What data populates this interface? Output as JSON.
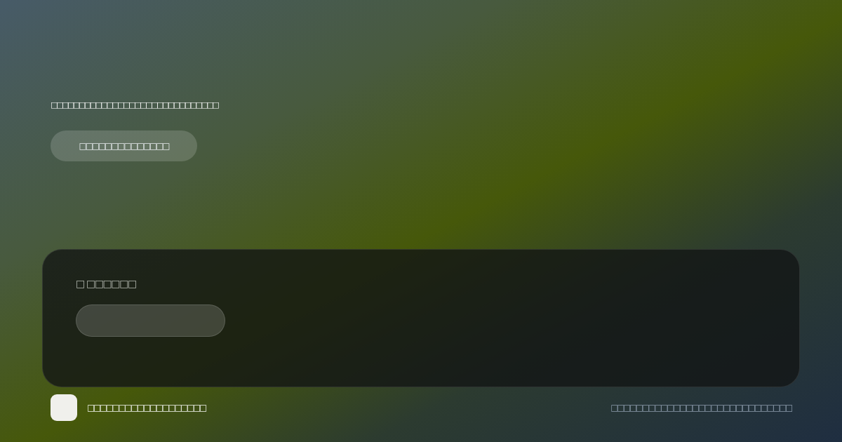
{
  "hero": {
    "headline": "□□□□□□□□□□□□□□□□□□□□□□□□□□□□□□",
    "button": "□□□□□□□□□□□□□□"
  },
  "card": {
    "label": "□ □□□□□□"
  },
  "footer": {
    "brand": "□□□□□□□□□□□□□□□□□□□",
    "note": "□□□□□□□□□□□□□□□□□□□□□□□□□□□□□"
  }
}
